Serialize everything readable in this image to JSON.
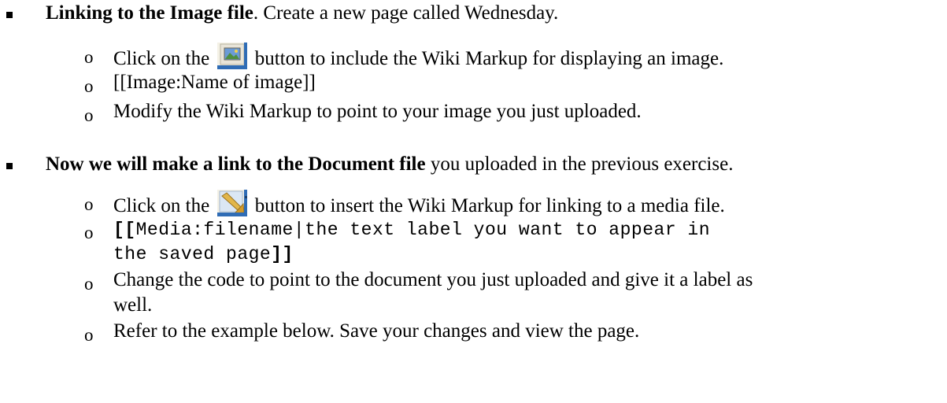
{
  "section1": {
    "heading_bold": "Linking to the Image file",
    "heading_rest": ".  Create a new page called Wednesday.",
    "items": [
      {
        "before": "Click on the",
        "icon": "image-button-icon",
        "after": "button to include the Wiki Markup for displaying an image."
      },
      {
        "text": "[[Image:Name of image]]"
      },
      {
        "text": "Modify the Wiki Markup to point to your image you just uploaded."
      }
    ]
  },
  "section2": {
    "heading_bold": "Now we will make a link to the Document file",
    "heading_rest": " you uploaded in the previous exercise.",
    "items": [
      {
        "before": "Click on the",
        "icon": "media-button-icon",
        "after": "button to insert the Wiki Markup for linking to a media file."
      },
      {
        "code_open": "[[",
        "code_body_line1": "Media:filename|the text label you want to appear in",
        "code_body_line2": "the saved page",
        "code_close": "]]"
      },
      {
        "text_line1": "Change the code to point to the document you just uploaded and give it a label as",
        "text_line2": "well."
      },
      {
        "text": "Refer to the example below.  Save your changes and view the page."
      }
    ]
  },
  "bullet_marker_sub": "o",
  "colors": {
    "text": "#000000",
    "background": "#ffffff",
    "icon_blue": "#4a7fc1",
    "icon_frame": "#e8e4d8"
  }
}
